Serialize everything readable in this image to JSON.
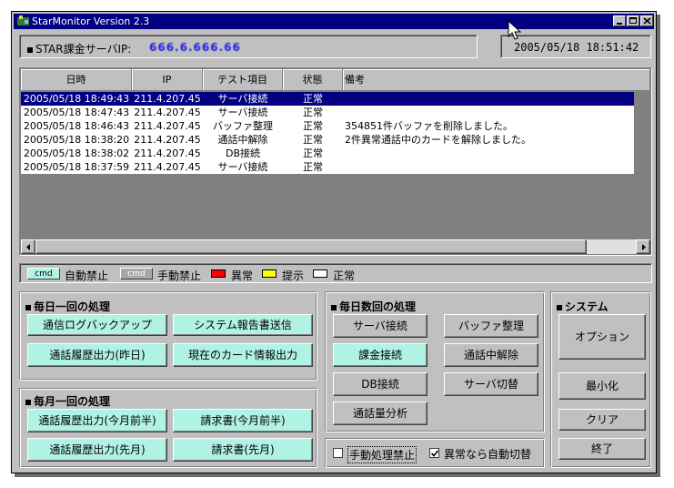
{
  "window": {
    "title": "StarMonitor Version 2.3"
  },
  "header": {
    "server_label": "STAR課金サーバIP:",
    "server_ip": "666.6.666.66",
    "datetime": "2005/05/18  18:51:42"
  },
  "table": {
    "columns": [
      "日時",
      "IP",
      "テスト項目",
      "状態",
      "備考"
    ],
    "rows": [
      [
        "2005/05/18 18:49:43",
        "211.4.207.45",
        "サーバ接続",
        "正常",
        ""
      ],
      [
        "2005/05/18 18:47:43",
        "211.4.207.45",
        "サーバ接続",
        "正常",
        ""
      ],
      [
        "2005/05/18 18:46:43",
        "211.4.207.45",
        "バッファ整理",
        "正常",
        "354851件バッファを削除しました。"
      ],
      [
        "2005/05/18 18:38:20",
        "211.4.207.45",
        "通話中解除",
        "正常",
        "2件異常通話中のカードを解除しました。"
      ],
      [
        "2005/05/18 18:38:02",
        "211.4.207.45",
        "DB接続",
        "正常",
        ""
      ],
      [
        "2005/05/18 18:37:59",
        "211.4.207.45",
        "サーバ接続",
        "正常",
        ""
      ]
    ]
  },
  "legend": {
    "cmd": "cmd",
    "auto_disable": "自動禁止",
    "manual_disable": "手動禁止",
    "abnormal": "異常",
    "notice": "提示",
    "normal": "正常",
    "colors": {
      "auto_cmd": "#b0f2e4",
      "manual_cmd": "#a8a8a8",
      "abnormal": "#ff0000",
      "notice": "#ffff00",
      "normal": "#ffffff"
    }
  },
  "daily_once": {
    "title": "毎日一回の処理",
    "buttons": [
      "通信ログバックアップ",
      "システム報告書送信",
      "通話履歴出力(昨日)",
      "現在のカード情報出力"
    ]
  },
  "monthly_once": {
    "title": "毎月一回の処理",
    "buttons": [
      "通話履歴出力(今月前半)",
      "請求書(今月前半)",
      "通話履歴出力(先月)",
      "請求書(先月)"
    ]
  },
  "daily_multi": {
    "title": "毎日数回の処理",
    "buttons": [
      "サーバ接続",
      "バッファ整理",
      "課金接続",
      "通話中解除",
      "DB接続",
      "サーバ切替",
      "通話量分析"
    ]
  },
  "options": {
    "manual_disable": "手動処理禁止",
    "auto_switch": "異常なら自動切替"
  },
  "system": {
    "title": "システム",
    "buttons": [
      "オプション",
      "最小化",
      "クリア",
      "終了"
    ]
  }
}
